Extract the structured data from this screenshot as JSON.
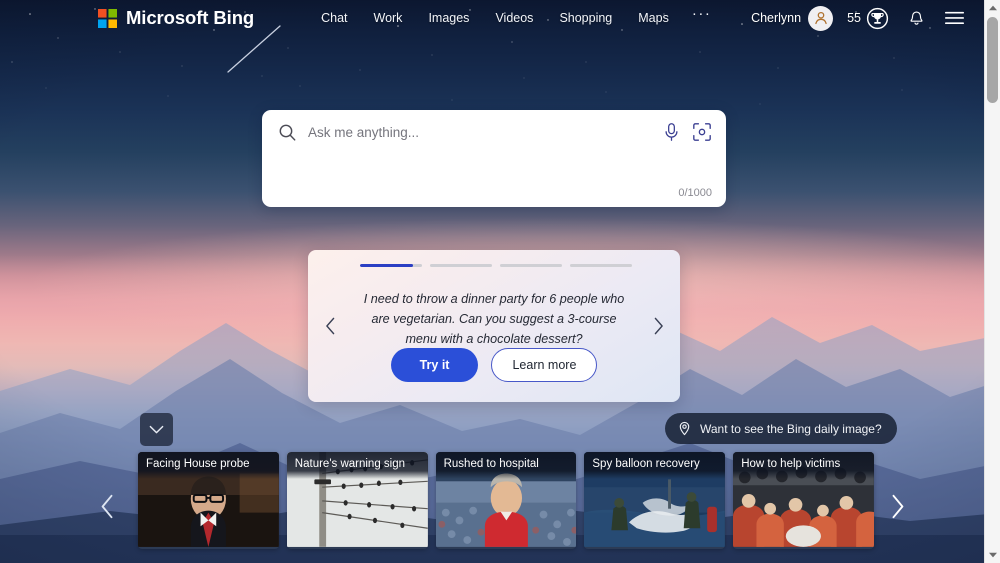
{
  "header": {
    "brand": "Microsoft Bing",
    "logo_icon": "microsoft-logo-icon",
    "nav": [
      {
        "label": "Chat"
      },
      {
        "label": "Work"
      },
      {
        "label": "Images"
      },
      {
        "label": "Videos"
      },
      {
        "label": "Shopping"
      },
      {
        "label": "Maps"
      }
    ],
    "more_label": "···",
    "user_name": "Cherlynn",
    "avatar_icon": "user-avatar-icon",
    "rewards_count": "55",
    "rewards_icon": "rewards-trophy-icon",
    "notifications_icon": "bell-icon",
    "menu_icon": "hamburger-menu-icon"
  },
  "search": {
    "placeholder": "Ask me anything...",
    "value": "",
    "counter": "0/1000",
    "search_icon": "search-icon",
    "mic_icon": "microphone-icon",
    "lens_icon": "visual-search-icon"
  },
  "promo": {
    "prompt": "I need to throw a dinner party for 6 people who are vegetarian. Can you suggest a 3-course menu with a chocolate dessert?",
    "try_label": "Try it",
    "learn_label": "Learn more",
    "prev_icon": "chevron-left-icon",
    "next_icon": "chevron-right-icon",
    "progress": [
      85,
      0,
      0,
      0
    ],
    "accent_color": "#2b3fc4",
    "button_color": "#2b4fd8"
  },
  "daily_image": {
    "label": "Want to see the Bing daily image?",
    "icon": "info-pin-icon"
  },
  "collapse_button": {
    "icon": "chevron-down-icon"
  },
  "news": {
    "prev_icon": "chevron-left-icon",
    "next_icon": "chevron-right-icon",
    "cards": [
      {
        "title": "Facing House probe",
        "thumb": "man-suit-red-tie"
      },
      {
        "title": "Nature's warning sign",
        "thumb": "birds-on-powerlines"
      },
      {
        "title": "Rushed to hospital",
        "thumb": "man-red-shirt-stadium"
      },
      {
        "title": "Spy balloon recovery",
        "thumb": "navy-boat-balloon-debris"
      },
      {
        "title": "How to help victims",
        "thumb": "crowd-of-people"
      }
    ]
  },
  "scrollbar": {
    "up_icon": "scroll-up-arrow-icon",
    "down_icon": "scroll-down-arrow-icon"
  }
}
